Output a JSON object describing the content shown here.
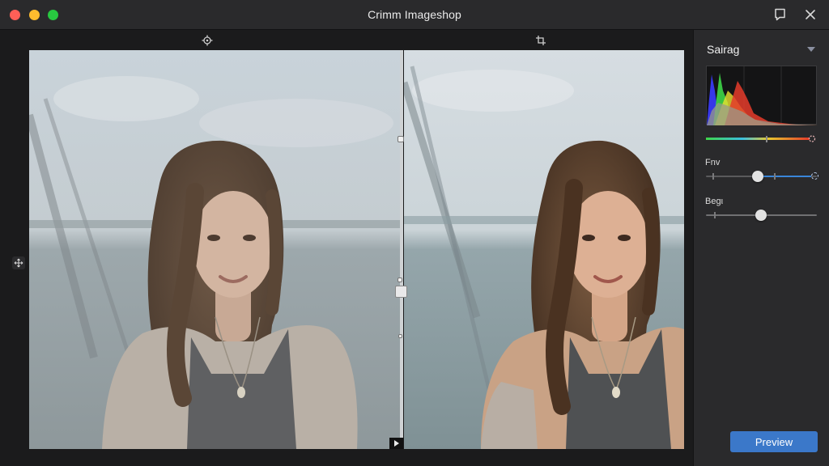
{
  "window": {
    "title": "Crimm Imageshop"
  },
  "titlebar_icons": [
    "note-icon",
    "close-icon"
  ],
  "canvas": {
    "tools": [
      "move-icon",
      "crop-icon"
    ],
    "side_tool": "move-icon",
    "compare_divider": "before-after split"
  },
  "panel": {
    "title": "Sairag",
    "histogram_colors": [
      "#3b3bff",
      "#3fe04a",
      "#e8e12f",
      "#e53b2a",
      "#9a9a8a"
    ],
    "sliders": [
      {
        "label": "Fnv",
        "value_fraction": 0.47
      },
      {
        "label": "Begι",
        "value_fraction": 0.5
      }
    ],
    "preview_label": "Preview"
  },
  "colors": {
    "accent": "#3b78c9",
    "background": "#1e1e20",
    "panel": "#2a2a2c"
  }
}
